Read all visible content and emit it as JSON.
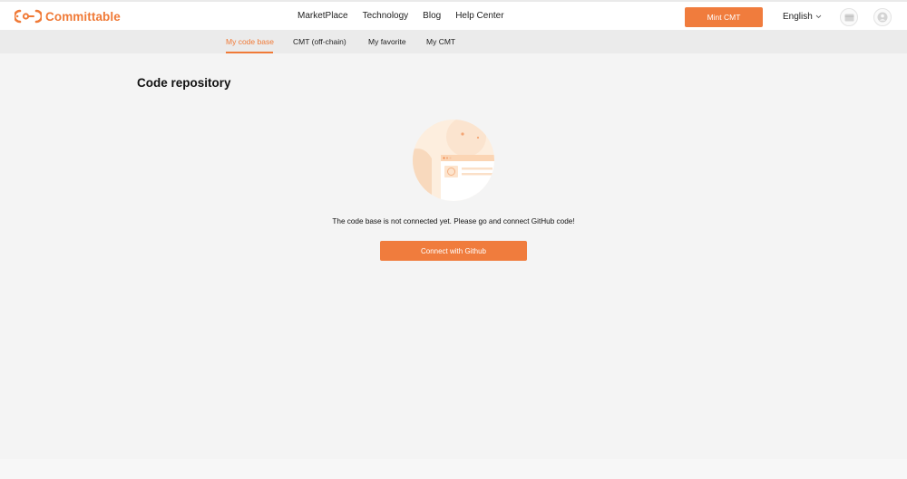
{
  "brand": {
    "name": "Committable",
    "accent_color": "#f07a37"
  },
  "nav": {
    "items": [
      {
        "label": "MarketPlace"
      },
      {
        "label": "Technology"
      },
      {
        "label": "Blog"
      },
      {
        "label": "Help Center"
      }
    ]
  },
  "header": {
    "mint_button_label": "Mint CMT",
    "language": "English",
    "wallet_icon": "wallet-icon",
    "user_icon": "user-avatar-icon"
  },
  "tabs": [
    {
      "label": "My code base",
      "active": true
    },
    {
      "label": "CMT (off-chain)",
      "active": false
    },
    {
      "label": "My favorite",
      "active": false
    },
    {
      "label": "My CMT",
      "active": false
    }
  ],
  "main": {
    "title": "Code repository",
    "empty_message": "The code base is not connected yet. Please go and connect GitHub code!",
    "connect_button_label": "Connect with Github"
  }
}
